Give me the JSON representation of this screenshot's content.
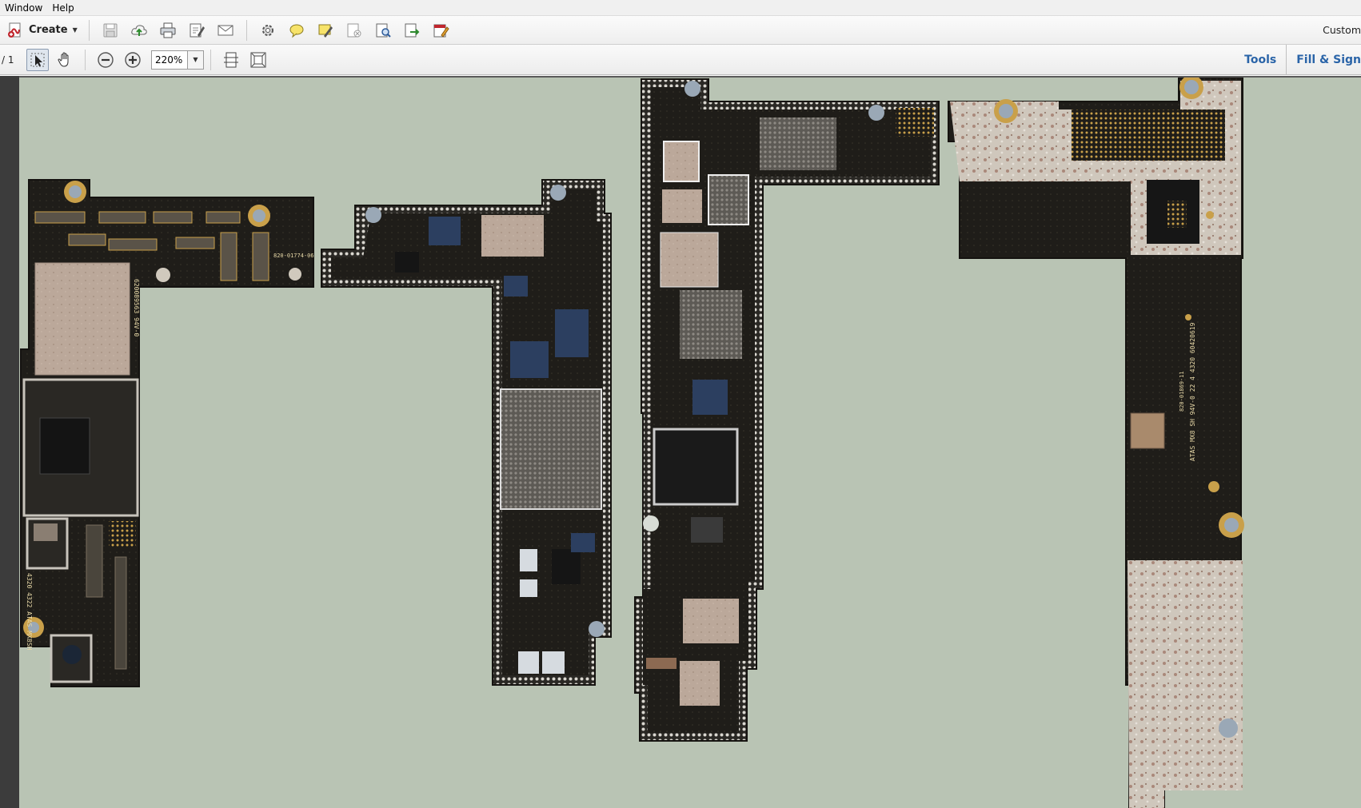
{
  "menubar": {
    "items": [
      "Window",
      "Help"
    ]
  },
  "toolbar": {
    "create_label": "Create",
    "buttons": [
      "save-icon",
      "upload-cloud-icon",
      "print-icon",
      "edit-icon",
      "email-icon",
      "gear-icon",
      "comment-icon",
      "highlight-icon",
      "redact-icon",
      "scan-icon",
      "export-icon",
      "sign-icon"
    ],
    "customize_label": "Custom"
  },
  "toolbar2": {
    "page_count": "/ 1",
    "zoom_value": "220%",
    "tools_label": "Tools",
    "fill_sign_label": "Fill & Sign"
  },
  "document": {
    "board_labels": {
      "b1_code": "820-01774-06",
      "b1_side": "620089563 94V-0",
      "b1_bottom": "4320 4322 ATAS MX8SH",
      "b4_code": "820-01869-11",
      "b4_info": "ATAS MX8 SH 94V-0 22 4 4320 60420619"
    },
    "colors": {
      "background": "#b9c4b4",
      "pcb": "#1e1c18",
      "shield": "#bfa99a",
      "gold": "#c9a04a",
      "blue_chip": "#2c3f60"
    }
  }
}
